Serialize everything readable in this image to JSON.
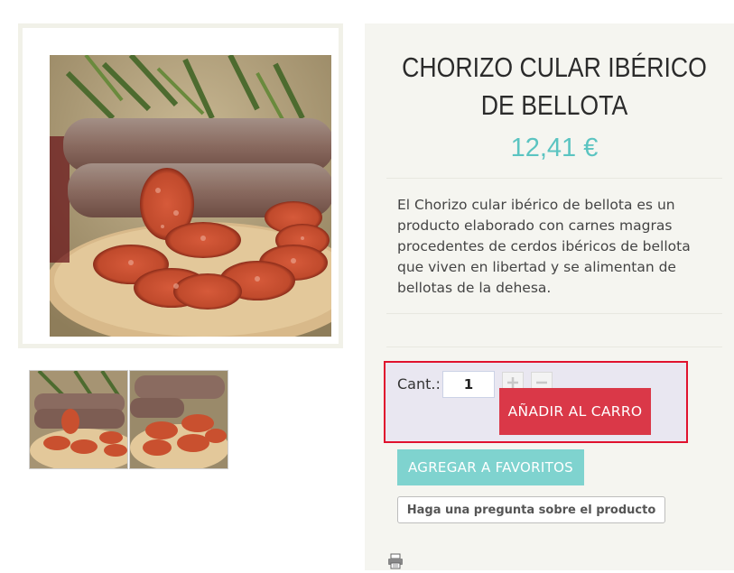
{
  "product": {
    "title": "CHORIZO CULAR IBÉRICO DE BELLOTA",
    "price": "12,41 €",
    "description": "El Chorizo cular ibérico de bellota es un producto elaborado con carnes magras procedentes de cerdos ibéricos de bellota que viven en libertad y se alimentan de bellotas de la dehesa."
  },
  "cart": {
    "qty_label": "Cant.:",
    "qty_value": "1",
    "add_label": "AÑADIR AL CARRO"
  },
  "actions": {
    "favorites_label": "AGREGAR A FAVORITOS",
    "ask_label": "Haga una pregunta sobre el producto"
  },
  "colors": {
    "price": "#5bc4c1",
    "add_to_cart": "#da3848",
    "favorites": "#7fd3cf",
    "highlight_border": "#e0122e"
  },
  "icons": [
    "plus-icon",
    "minus-icon",
    "printer-icon"
  ]
}
